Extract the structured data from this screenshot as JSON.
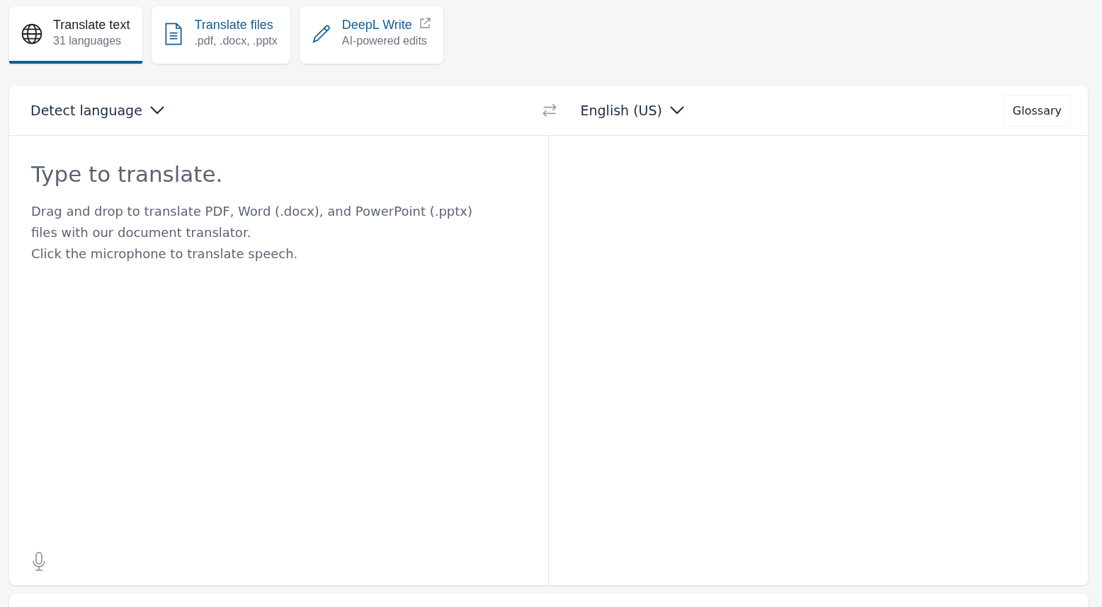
{
  "tabs": [
    {
      "kind": "globe",
      "title": "Translate text",
      "subtitle": "31 languages",
      "selected": true,
      "external": false
    },
    {
      "kind": "file",
      "title": "Translate files",
      "subtitle": ".pdf, .docx, .pptx",
      "selected": false,
      "external": false
    },
    {
      "kind": "pencil",
      "title": "DeepL Write",
      "subtitle": "AI-powered edits",
      "selected": false,
      "external": true
    }
  ],
  "translator": {
    "source_language": "Detect language",
    "target_language": "English (US)",
    "glossary_button": "Glossary",
    "source": {
      "placeholder": "Type to translate.",
      "hints": [
        "Drag and drop to translate PDF, Word (.docx), and PowerPoint (.pptx) files with our document translator.",
        "Click the microphone to translate speech."
      ]
    }
  }
}
